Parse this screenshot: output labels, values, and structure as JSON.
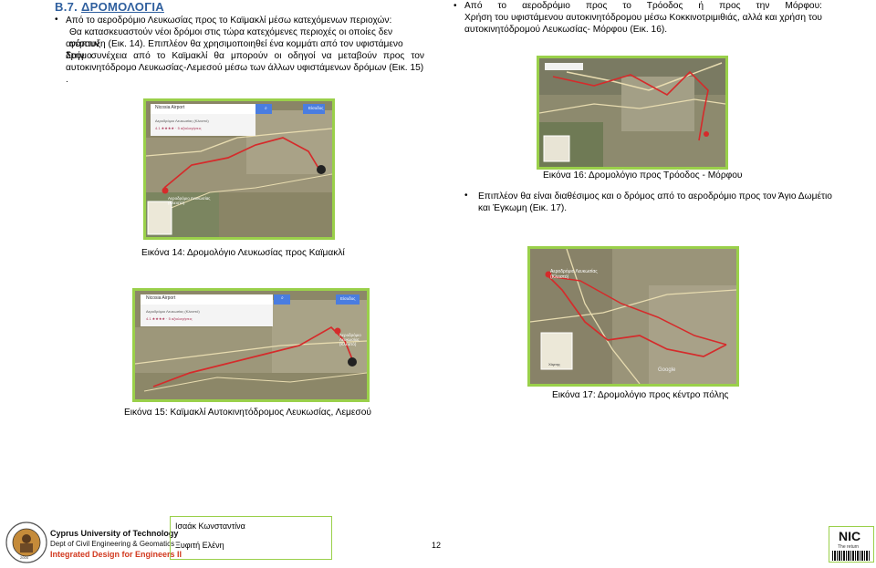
{
  "section_title": {
    "number": "B.7.",
    "title": "ΔΡΟΜΟΛΟΓΙΑ"
  },
  "left_col": {
    "bullet1_line1": "Από το αεροδρόμιο Λευκωσίας προς το Καϊμακλί μέσω κατεχόμενων περιοχών:",
    "bullet1_lines": [
      "Θα κατασκευαστούν νέοι δρόμοι στις τώρα κατεχόμενες περιοχές οι οποίες δεν φέρουν",
      "ανάπτυξη (Εικ. 14). Επιπλέον θα χρησιμοποιηθεί ένα κομμάτι από τον υφιστάμενο δρόμο.",
      "Στην συνέχεια από το Καϊμακλί θα μπορούν οι οδηγοί να μεταβούν προς τον",
      "αυτοκινητόδρομο Λευκωσίας-Λεμεσού μέσω των άλλων υφιστάμενων δρόμων (Εικ. 15) ."
    ],
    "caption14": "Εικόνα 14: Δρομολόγιο Λευκωσίας προς Καϊμακλί",
    "caption15": "Εικόνα 15: Καϊμακλί Αυτοκινητόδρομος Λευκωσίας, Λεμεσού"
  },
  "right_col": {
    "bullet2_lines": [
      "Από το αεροδρόμιο προς το Τρόοδος ή προς την Μόρφου:",
      "Χρήση του υφιστάμενου αυτοκινητόδρομου μέσω Κοκκινοτριμιθιάς, αλλά και χρήση του",
      "αυτοκινητόδρομού Λευκωσίας- Μόρφου (Εικ. 16)."
    ],
    "caption16": "Εικόνα 16: Δρομολόγιο προς Τρόοδος - Μόρφου",
    "bullet3_lines": [
      "Επιπλέον θα είναι διαθέσιμος και ο δρόμος από το αεροδρόμιο προς τον Άγιο Δωμέτιο",
      "και Έγκωμη (Εικ. 17)."
    ],
    "caption17": "Εικόνα 17: Δρομολόγιο προς κέντρο πόλης"
  },
  "maps": {
    "search_value": "Nicosia Airport",
    "search_value2": "Nicosia Airport",
    "subresult": "Αεροδρόμιο Λευκωσίας (Κλειστό)",
    "reviews": "4.1 ★★★★ · 5 αξιολογήσεις",
    "login_label": "Είσοδος",
    "marker_label": "Αεροδρόμιο Λευκωσίας (Κλειστό)",
    "marker_label_fig17": "Αεροδρόμιο Λευκωσίας (Κλειστό)",
    "thumb_label": "Χάρτης",
    "google": "Google"
  },
  "footer": {
    "university": "Cyprus University of Technology",
    "dept": "Dept of Civil Engineering & Geomatics",
    "course": "Integrated Design for Engineers II",
    "author1": "Ισαάκ Κωνσταντίνα",
    "author2": "Ξυφιτή Ελένη",
    "page": "12",
    "nic_title": "NIC",
    "nic_sub": "The return",
    "seal_year": "2004"
  }
}
